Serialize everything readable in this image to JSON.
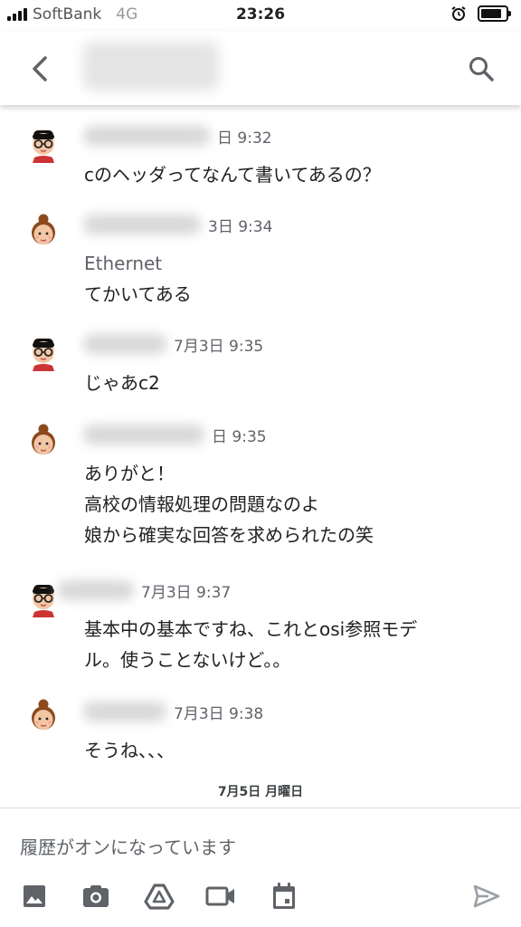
{
  "status": {
    "carrier": "SoftBank",
    "network": "4G",
    "time": "23:26"
  },
  "header": {
    "back_icon": "arrow-back-icon",
    "search_icon": "search-icon"
  },
  "messages": [
    {
      "avatar": "man-glasses-avatar",
      "time": "日 9:32",
      "lines": [
        "cのヘッダってなんて書いてあるの？"
      ]
    },
    {
      "avatar": "woman-bun-avatar",
      "time": "3日 9:34",
      "lines": [
        "Ethernet",
        "てかいてある"
      ]
    },
    {
      "avatar": "man-glasses-avatar",
      "time": "7月3日 9:35",
      "lines": [
        "じゃあc2"
      ]
    },
    {
      "avatar": "woman-bun-avatar",
      "time": "日 9:35",
      "lines": [
        "ありがと！",
        "高校の情報処理の問題なのよ",
        "娘から確実な回答を求められたの笑"
      ]
    },
    {
      "avatar": "man-glasses-avatar",
      "time": "7月3日 9:37",
      "lines": [
        "基本中の基本ですね、これとosi参照モデ",
        "ル。使うことないけど。。"
      ]
    },
    {
      "avatar": "woman-bun-avatar",
      "time": "7月3日 9:38",
      "lines": [
        "そうね、、、"
      ]
    }
  ],
  "day_separator": "7月5日 月曜日",
  "composer": {
    "placeholder": "履歴がオンになっています"
  },
  "toolbar": [
    "image-icon",
    "camera-icon",
    "drive-icon",
    "video-icon",
    "calendar-icon",
    "send-icon"
  ]
}
